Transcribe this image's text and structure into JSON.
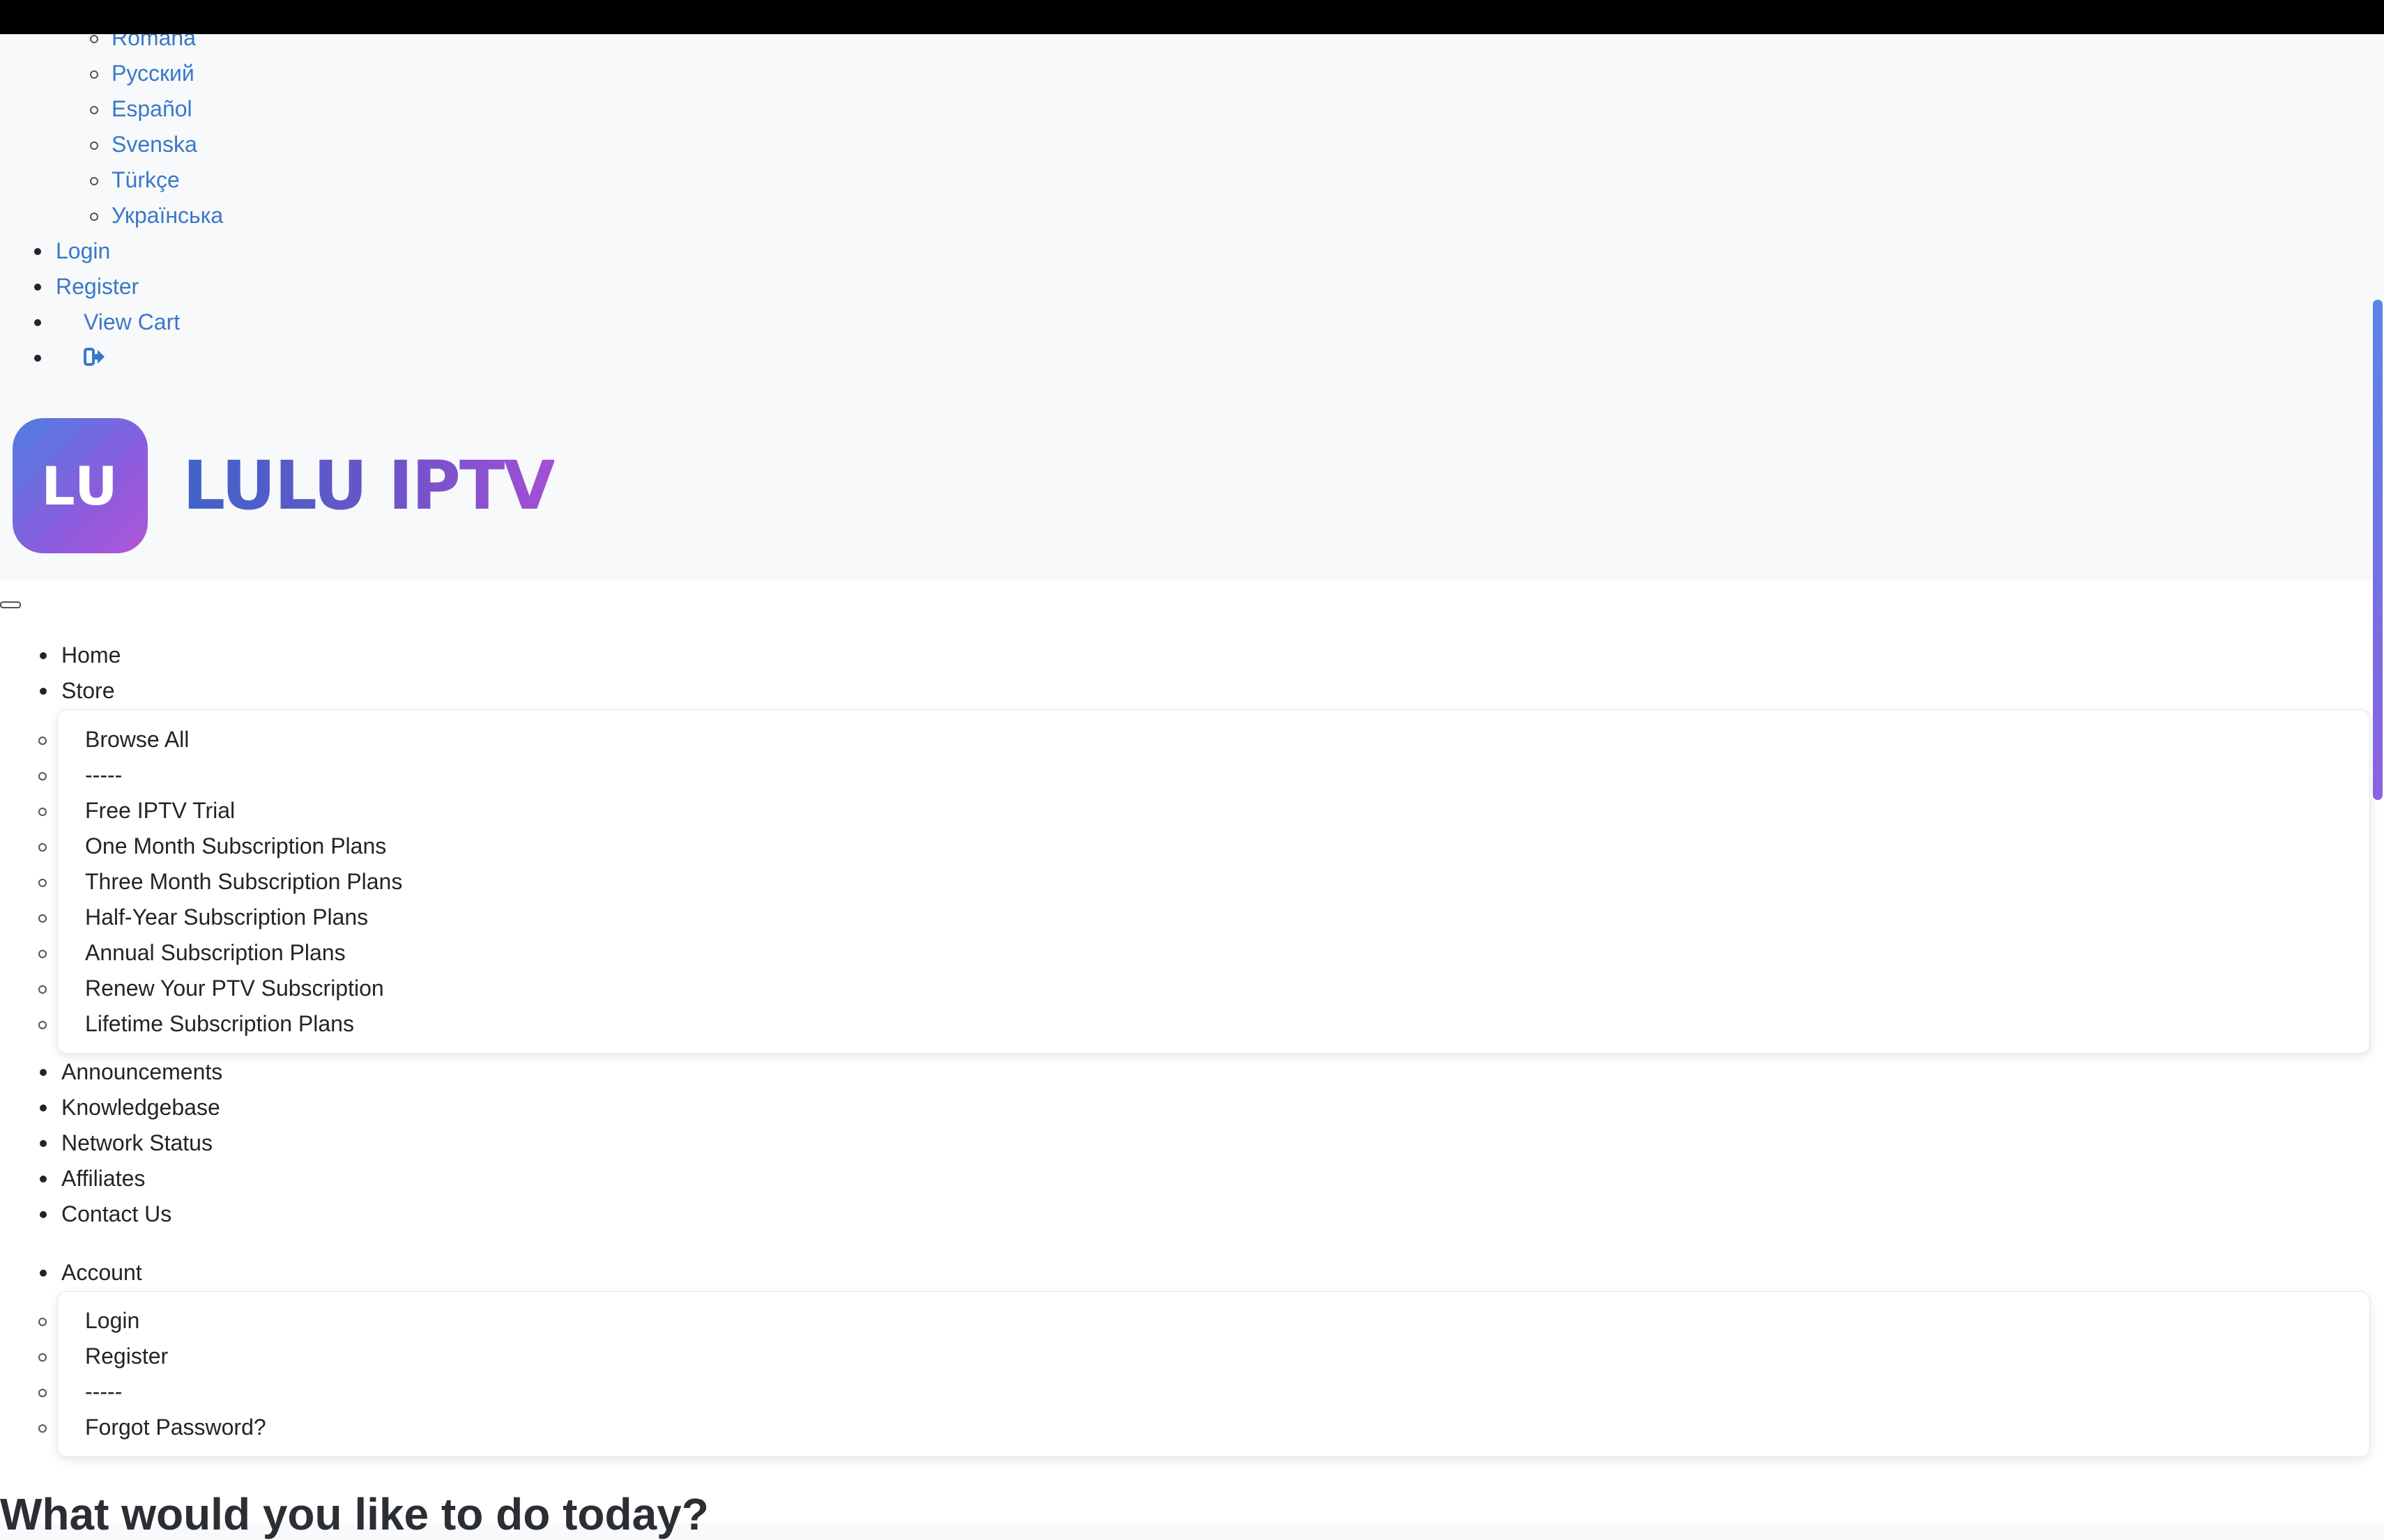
{
  "languages": [
    "Română",
    "Русский",
    "Español",
    "Svenska",
    "Türkçe",
    "Українська"
  ],
  "user_links": {
    "login": "Login",
    "register": "Register",
    "view_cart": "View Cart"
  },
  "logo": {
    "badge_text": "LU",
    "brand_text": "LULU IPTV"
  },
  "nav": {
    "home": "Home",
    "store": "Store",
    "store_menu": [
      "Browse All",
      "-----",
      "Free IPTV Trial",
      "One Month Subscription Plans",
      "Three Month Subscription Plans",
      "Half-Year Subscription Plans",
      "Annual Subscription Plans",
      "Renew Your PTV Subscription",
      "Lifetime Subscription Plans"
    ],
    "more_items": [
      "Announcements",
      "Knowledgebase",
      "Network Status",
      "Affiliates",
      "Contact Us"
    ]
  },
  "account": {
    "label": "Account",
    "menu": [
      "Login",
      "Register",
      "-----",
      "Forgot Password?"
    ]
  },
  "heading": "What would you like to do today?"
}
